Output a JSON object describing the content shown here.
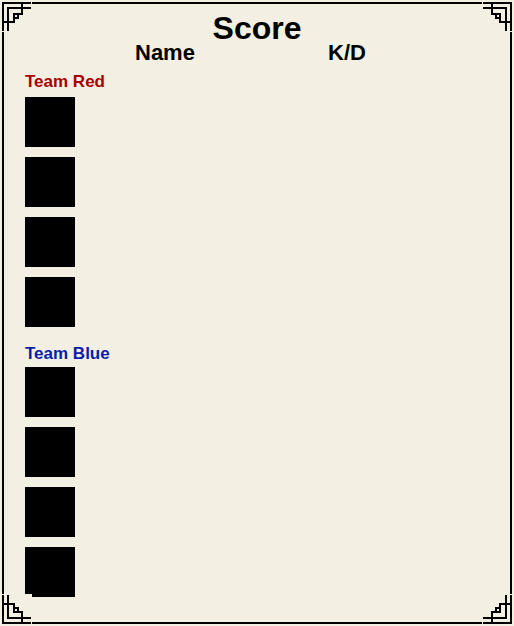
{
  "title": "Score",
  "columns": [
    "Name",
    "K/D"
  ],
  "teams": [
    {
      "name": "Team Red",
      "color": "#a80000",
      "players": [
        {
          "name": "",
          "kd": ""
        },
        {
          "name": "",
          "kd": ""
        },
        {
          "name": "",
          "kd": ""
        },
        {
          "name": "",
          "kd": ""
        }
      ]
    },
    {
      "name": "Team Blue",
      "color": "#0a1ea8",
      "players": [
        {
          "name": "",
          "kd": ""
        },
        {
          "name": "",
          "kd": ""
        },
        {
          "name": "",
          "kd": ""
        },
        {
          "name": "",
          "kd": ""
        }
      ]
    }
  ]
}
